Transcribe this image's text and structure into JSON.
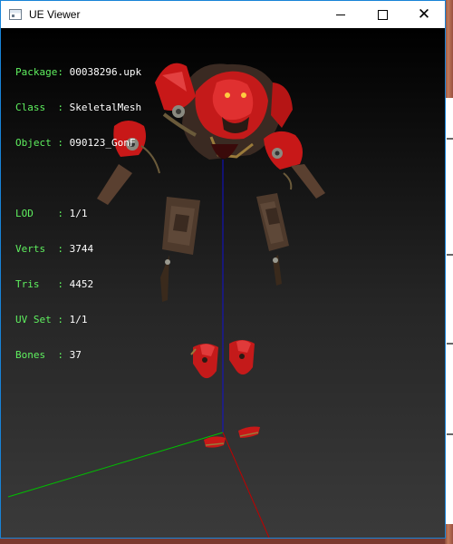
{
  "window": {
    "title": "UE Viewer",
    "app_icon": "window-app-icon",
    "controls": {
      "minimize_icon": "minimize-icon",
      "maximize_icon": "maximize-icon",
      "close_icon": "close-icon"
    }
  },
  "info": {
    "package": {
      "label": "Package:",
      "value": "00038296.upk"
    },
    "class": {
      "label": "Class  :",
      "value": "SkeletalMesh"
    },
    "object": {
      "label": "Object :",
      "value": "090123_GonF"
    },
    "lod": {
      "label": "LOD    :",
      "value": "1/1"
    },
    "verts": {
      "label": "Verts  :",
      "value": "3744"
    },
    "tris": {
      "label": "Tris   :",
      "value": "4452"
    },
    "uvset": {
      "label": "UV Set :",
      "value": "1/1"
    },
    "bones": {
      "label": "Bones  :",
      "value": "37"
    }
  },
  "colors": {
    "label_green": "#5ff05f",
    "axis_x": "#c00000",
    "axis_y": "#00c000",
    "axis_z": "#1010d0",
    "armor_red": "#c81818",
    "leather": "#5a4030",
    "gold": "#9a7a3a"
  }
}
